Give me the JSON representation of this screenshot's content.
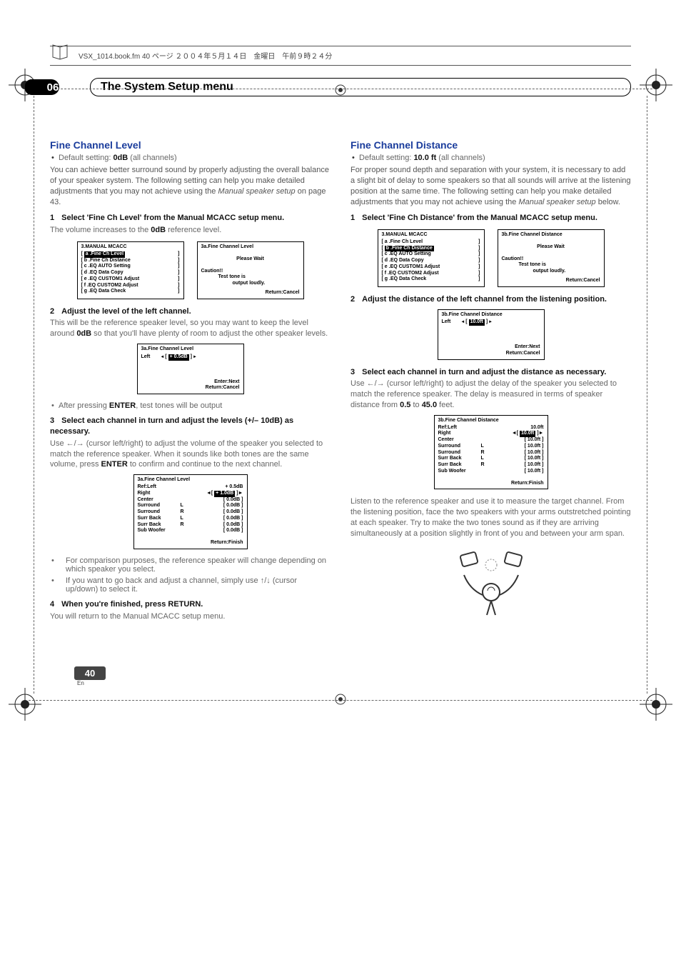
{
  "topbar": "VSX_1014.book.fm  40 ページ  ２００４年５月１４日　金曜日　午前９時２４分",
  "chapter": {
    "num": "06",
    "title": "The System Setup menu"
  },
  "left": {
    "h": "Fine Channel Level",
    "default": "Default setting: ",
    "default_val": "0dB",
    "default_tail": " (all channels)",
    "intro1": "You can achieve better surround sound by properly adjusting the overall balance of your speaker system. The following setting can help you make detailed adjustments that you may not achieve using the ",
    "intro1_i": "Manual speaker setup",
    "intro1_tail": " on page 43.",
    "step1": "Select 'Fine Ch Level' from the Manual MCACC setup menu.",
    "step1_sub_a": "The volume increases to the ",
    "step1_sub_b": "0dB",
    "step1_sub_c": " reference level.",
    "screenA_title": "3.MANUAL MCACC",
    "menu": [
      "a .Fine Ch Level",
      "b .Fine Ch Distance",
      "c .EQ AUTO Setting",
      "d .EQ Data Copy",
      "e .EQ CUSTOM1 Adjust",
      "f .EQ CUSTOM2 Adjust",
      "g .EQ Data Check"
    ],
    "screenB_title": "3a.Fine Channel Level",
    "please_wait": "Please Wait",
    "caution": "Caution!!",
    "testtone": "Test tone is",
    "loud": "output loudly.",
    "return_cancel": "Return:Cancel",
    "step2": "Adjust the level of the left channel.",
    "step2_body_a": "This will be the reference speaker level, so you may want to keep the level around ",
    "step2_body_b": "0dB",
    "step2_body_c": " so that you'll have plenty of room to adjust the other speaker levels.",
    "screenC_left": "Left",
    "screenC_val": "+ 0.5dB",
    "enter_next": "Enter:Next",
    "after_enter_a": "After pressing ",
    "after_enter_b": "ENTER",
    "after_enter_c": ", test tones will be output",
    "step3_a": "Select each channel in turn and adjust the levels (",
    "step3_b": "+/– 10dB",
    "step3_c": ") as necessary.",
    "step3_body_a": "Use ",
    "step3_body_b": " (cursor left/right) to adjust the volume of the speaker you selected to match the reference speaker. When it sounds like both tones are the same volume, press ",
    "step3_body_c": "ENTER",
    "step3_body_d": " to confirm and continue to the next channel.",
    "screenD_title": "3a.Fine Channel Level",
    "screenD_ref": "Ref:Left",
    "screenD_refval": "+ 0.5dB",
    "screenD_rows": [
      {
        "a": "Right",
        "b": "",
        "c": "+ 1.0dB",
        "hl": true
      },
      {
        "a": "Center",
        "b": "",
        "c": "0.0dB"
      },
      {
        "a": "Surround",
        "b": "L",
        "c": "0.0dB"
      },
      {
        "a": "Surround",
        "b": "R",
        "c": "0.0dB"
      },
      {
        "a": "Surr Back",
        "b": "L",
        "c": "0.0dB"
      },
      {
        "a": "Surr Back",
        "b": "R",
        "c": "0.0dB"
      },
      {
        "a": "Sub Woofer",
        "b": "",
        "c": "0.0dB"
      }
    ],
    "return_finish": "Return:Finish",
    "sub_bullet1": "For comparison purposes, the reference speaker will change depending on which speaker you select.",
    "sub_bullet2_a": "If you want to go back and adjust a channel, simply use ",
    "sub_bullet2_b": " (cursor up/down) to select it.",
    "step4": "When you're finished, press RETURN.",
    "step4_body": "You will return to the Manual MCACC setup menu."
  },
  "right": {
    "h": "Fine Channel Distance",
    "default": "Default setting: ",
    "default_val": "10.0 ft",
    "default_tail": " (all channels)",
    "intro_a": "For proper sound depth and separation with your system, it is necessary to add a slight bit of delay to some speakers so that all sounds will arrive at the listening position at the same time. The following setting can help you make detailed adjustments that you may not achieve using the ",
    "intro_i": "Manual speaker setup",
    "intro_b": " below.",
    "step1": "Select 'Fine Ch Distance' from the Manual MCACC setup menu.",
    "screenB_title": "3b.Fine Channel Distance",
    "step2": "Adjust the distance of the left channel from the listening position.",
    "screenC_left": "Left",
    "screenC_val": "10.0ft",
    "step3": "Select each channel in turn and adjust the distance as necessary.",
    "step3_body_a": "Use ",
    "step3_body_b": " (cursor left/right) to adjust the delay of the speaker you selected to match the reference speaker. The delay is measured in terms of speaker distance from ",
    "step3_body_c": "0.5",
    "step3_body_d": " to ",
    "step3_body_e": "45.0",
    "step3_body_f": " feet.",
    "screenD_title": "3b.Fine Channel Distance",
    "screenD_ref": "Ref:Left",
    "screenD_refval": "10.0ft",
    "screenD_rows": [
      {
        "a": "Right",
        "b": "",
        "c": "10.0ft",
        "hl": true
      },
      {
        "a": "Center",
        "b": "",
        "c": "10.0ft"
      },
      {
        "a": "Surround",
        "b": "L",
        "c": "10.0ft"
      },
      {
        "a": "Surround",
        "b": "R",
        "c": "10.0ft"
      },
      {
        "a": "Surr Back",
        "b": "L",
        "c": "10.0ft"
      },
      {
        "a": "Surr Back",
        "b": "R",
        "c": "10.0ft"
      },
      {
        "a": "Sub Woofer",
        "b": "",
        "c": "10.0ft"
      }
    ],
    "outro": "Listen to the reference speaker and use it to measure the target channel. From the listening position, face the two speakers with your arms outstretched pointing at each speaker. Try to make the two tones sound as if they are arriving simultaneously at a position slightly in front of you and between your arm span."
  },
  "page_num": "40",
  "page_lang": "En",
  "labels": {
    "n1": "1",
    "n2": "2",
    "n3": "3",
    "n4": "4"
  }
}
